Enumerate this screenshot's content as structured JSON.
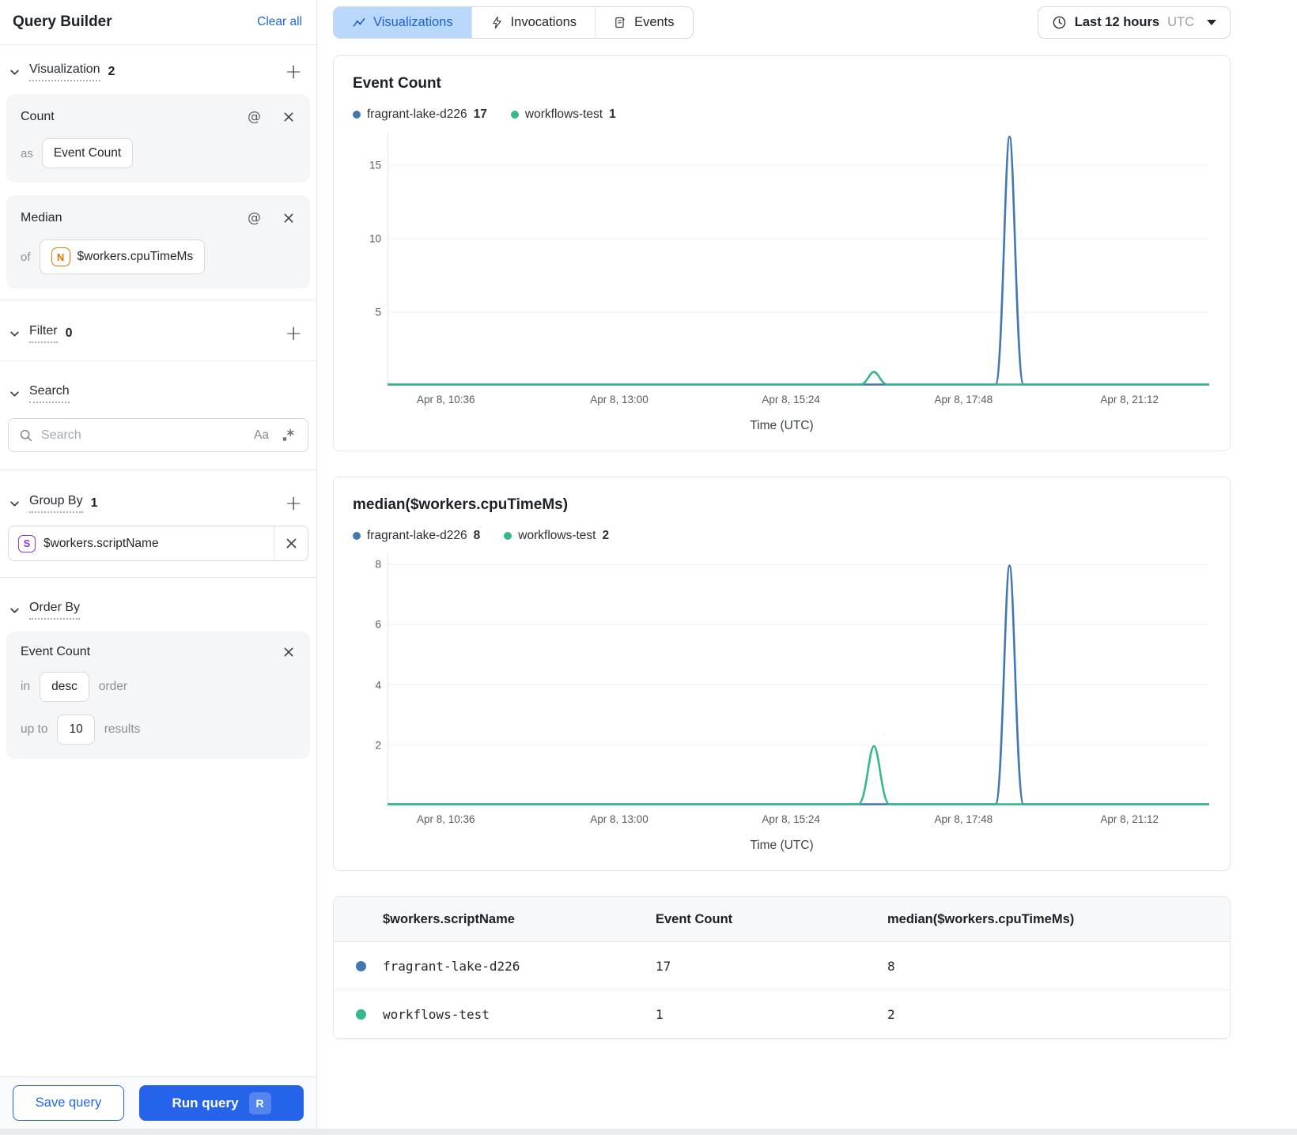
{
  "sidebar": {
    "title": "Query Builder",
    "clear_all": "Clear all",
    "sections": {
      "visualization": {
        "label": "Visualization",
        "count": "2"
      },
      "filter": {
        "label": "Filter",
        "count": "0"
      },
      "search": {
        "label": "Search"
      },
      "group_by": {
        "label": "Group By",
        "count": "1"
      },
      "order_by": {
        "label": "Order By"
      }
    },
    "count_card": {
      "title": "Count",
      "as_label": "as",
      "value": "Event Count"
    },
    "median_card": {
      "title": "Median",
      "of_label": "of",
      "field_badge": "N",
      "value": "$workers.cpuTimeMs"
    },
    "search_box": {
      "placeholder": "Search",
      "case_icon": "Aa"
    },
    "group_by_item": {
      "field_badge": "S",
      "value": "$workers.scriptName"
    },
    "order_by_card": {
      "title": "Event Count",
      "in_label": "in",
      "direction": "desc",
      "order_label": "order",
      "up_to_label": "up to",
      "limit": "10",
      "results_label": "results"
    },
    "footer": {
      "save": "Save query",
      "run": "Run query",
      "run_shortcut": "R"
    }
  },
  "topbar": {
    "tabs": [
      {
        "label": "Visualizations",
        "active": true
      },
      {
        "label": "Invocations",
        "active": false
      },
      {
        "label": "Events",
        "active": false
      }
    ],
    "time_range": {
      "label": "Last 12 hours",
      "timezone": "UTC"
    }
  },
  "colors": {
    "accent": "#2563eb",
    "active_tab_bg": "#b9d8fc",
    "blue_series": "#4377b2",
    "green_series": "#36b78f"
  },
  "chart_data": [
    {
      "type": "line",
      "title": "Event Count",
      "xlabel": "Time (UTC)",
      "grid": "horizontal",
      "legend_position": "top",
      "legend": [
        {
          "name": "fragrant-lake-d226",
          "total": "17"
        },
        {
          "name": "workflows-test",
          "total": "1"
        }
      ],
      "ylim": [
        0,
        17.2
      ],
      "y_ticks": [
        5,
        10,
        15
      ],
      "x_ticks": [
        {
          "label": "Apr 8, 10:36",
          "f": 0.071
        },
        {
          "label": "Apr 8, 13:00",
          "f": 0.282
        },
        {
          "label": "Apr 8, 15:24",
          "f": 0.491
        },
        {
          "label": "Apr 8, 17:48",
          "f": 0.701
        },
        {
          "label": "Apr 8, 21:12",
          "f": 0.903
        }
      ],
      "series": [
        {
          "name": "fragrant-lake-d226",
          "color": "#4377b2",
          "baseline": 0,
          "spikes": [
            {
              "f": 0.757,
              "half_width_f": 0.017,
              "peak": 17,
              "peak_time_approx": "Apr 8, ~18:25"
            }
          ]
        },
        {
          "name": "workflows-test",
          "color": "#36b78f",
          "baseline": 0,
          "spikes": [
            {
              "f": 0.592,
              "half_width_f": 0.017,
              "peak": 1,
              "peak_time_approx": "Apr 8, ~16:30"
            }
          ]
        }
      ]
    },
    {
      "type": "line",
      "title": "median($workers.cpuTimeMs)",
      "xlabel": "Time (UTC)",
      "grid": "horizontal",
      "legend_position": "top",
      "legend": [
        {
          "name": "fragrant-lake-d226",
          "total": "8"
        },
        {
          "name": "workflows-test",
          "total": "2"
        }
      ],
      "ylim": [
        0,
        8.35
      ],
      "y_ticks": [
        2,
        4,
        6,
        8
      ],
      "x_ticks": [
        {
          "label": "Apr 8, 10:36",
          "f": 0.071
        },
        {
          "label": "Apr 8, 13:00",
          "f": 0.282
        },
        {
          "label": "Apr 8, 15:24",
          "f": 0.491
        },
        {
          "label": "Apr 8, 17:48",
          "f": 0.701
        },
        {
          "label": "Apr 8, 21:12",
          "f": 0.903
        }
      ],
      "series": [
        {
          "name": "fragrant-lake-d226",
          "color": "#4377b2",
          "baseline": 0,
          "spikes": [
            {
              "f": 0.757,
              "half_width_f": 0.017,
              "peak": 8,
              "peak_time_approx": "Apr 8, ~18:25"
            }
          ]
        },
        {
          "name": "workflows-test",
          "color": "#36b78f",
          "baseline": 0,
          "spikes": [
            {
              "f": 0.592,
              "half_width_f": 0.019,
              "peak": 2,
              "peak_time_approx": "Apr 8, ~16:30"
            }
          ]
        }
      ]
    }
  ],
  "table": {
    "columns": [
      "$workers.scriptName",
      "Event Count",
      "median($workers.cpuTimeMs)"
    ],
    "rows": [
      {
        "color": "#4377b2",
        "name": "fragrant-lake-d226",
        "event_count": "17",
        "median": "8"
      },
      {
        "color": "#36b78f",
        "name": "workflows-test",
        "event_count": "1",
        "median": "2"
      }
    ]
  }
}
